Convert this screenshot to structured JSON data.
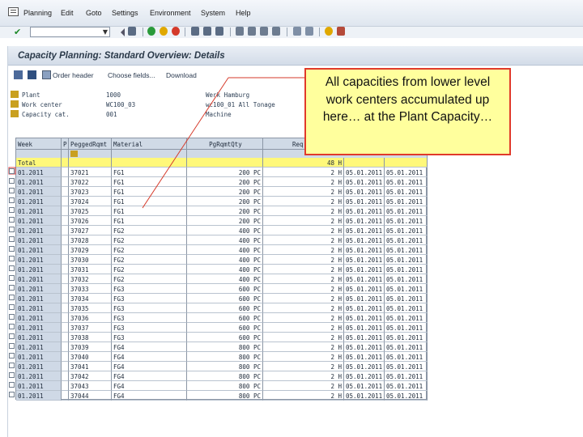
{
  "menubar": {
    "items": [
      "Planning",
      "Edit",
      "Goto",
      "Settings",
      "Environment",
      "System",
      "Help"
    ]
  },
  "toolbar": {
    "command_value": ""
  },
  "title": {
    "text": "Capacity Planning: Standard Overview: Details"
  },
  "app_toolbar": {
    "order_header": "Order header",
    "choose_fields": "Choose fields...",
    "download": "Download"
  },
  "header": {
    "plant_label": "Plant",
    "plant_value": "1000",
    "plant_desc": "Werk Hamburg",
    "work_center_label": "Work center",
    "work_center_value": "WC100_03",
    "work_center_desc": "wc100_01 All Tonage",
    "capacity_cat_label": "Capacity cat.",
    "capacity_cat_value": "001",
    "capacity_cat_desc": "Machine"
  },
  "grid": {
    "columns": {
      "week": "Week",
      "p": "P",
      "pegged": "PeggedRqmt",
      "material": "Material",
      "pgqty": "PgRqmtQty",
      "req": "Req"
    },
    "total": {
      "week": "Total",
      "req": "48 H"
    },
    "rows": [
      {
        "week": "01.2011",
        "pegged": "37021",
        "material": "FG1",
        "pgqty": "200 PC",
        "req": "2 H",
        "d1": "05.01.2011",
        "d2": "05.01.2011"
      },
      {
        "week": "01.2011",
        "pegged": "37022",
        "material": "FG1",
        "pgqty": "200 PC",
        "req": "2 H",
        "d1": "05.01.2011",
        "d2": "05.01.2011"
      },
      {
        "week": "01.2011",
        "pegged": "37023",
        "material": "FG1",
        "pgqty": "200 PC",
        "req": "2 H",
        "d1": "05.01.2011",
        "d2": "05.01.2011"
      },
      {
        "week": "01.2011",
        "pegged": "37024",
        "material": "FG1",
        "pgqty": "200 PC",
        "req": "2 H",
        "d1": "05.01.2011",
        "d2": "05.01.2011"
      },
      {
        "week": "01.2011",
        "pegged": "37025",
        "material": "FG1",
        "pgqty": "200 PC",
        "req": "2 H",
        "d1": "05.01.2011",
        "d2": "05.01.2011"
      },
      {
        "week": "01.2011",
        "pegged": "37026",
        "material": "FG1",
        "pgqty": "200 PC",
        "req": "2 H",
        "d1": "05.01.2011",
        "d2": "05.01.2011"
      },
      {
        "week": "01.2011",
        "pegged": "37027",
        "material": "FG2",
        "pgqty": "400 PC",
        "req": "2 H",
        "d1": "05.01.2011",
        "d2": "05.01.2011"
      },
      {
        "week": "01.2011",
        "pegged": "37028",
        "material": "FG2",
        "pgqty": "400 PC",
        "req": "2 H",
        "d1": "05.01.2011",
        "d2": "05.01.2011"
      },
      {
        "week": "01.2011",
        "pegged": "37029",
        "material": "FG2",
        "pgqty": "400 PC",
        "req": "2 H",
        "d1": "05.01.2011",
        "d2": "05.01.2011"
      },
      {
        "week": "01.2011",
        "pegged": "37030",
        "material": "FG2",
        "pgqty": "400 PC",
        "req": "2 H",
        "d1": "05.01.2011",
        "d2": "05.01.2011"
      },
      {
        "week": "01.2011",
        "pegged": "37031",
        "material": "FG2",
        "pgqty": "400 PC",
        "req": "2 H",
        "d1": "05.01.2011",
        "d2": "05.01.2011"
      },
      {
        "week": "01.2011",
        "pegged": "37032",
        "material": "FG2",
        "pgqty": "400 PC",
        "req": "2 H",
        "d1": "05.01.2011",
        "d2": "05.01.2011"
      },
      {
        "week": "01.2011",
        "pegged": "37033",
        "material": "FG3",
        "pgqty": "600 PC",
        "req": "2 H",
        "d1": "05.01.2011",
        "d2": "05.01.2011"
      },
      {
        "week": "01.2011",
        "pegged": "37034",
        "material": "FG3",
        "pgqty": "600 PC",
        "req": "2 H",
        "d1": "05.01.2011",
        "d2": "05.01.2011"
      },
      {
        "week": "01.2011",
        "pegged": "37035",
        "material": "FG3",
        "pgqty": "600 PC",
        "req": "2 H",
        "d1": "05.01.2011",
        "d2": "05.01.2011"
      },
      {
        "week": "01.2011",
        "pegged": "37036",
        "material": "FG3",
        "pgqty": "600 PC",
        "req": "2 H",
        "d1": "05.01.2011",
        "d2": "05.01.2011"
      },
      {
        "week": "01.2011",
        "pegged": "37037",
        "material": "FG3",
        "pgqty": "600 PC",
        "req": "2 H",
        "d1": "05.01.2011",
        "d2": "05.01.2011"
      },
      {
        "week": "01.2011",
        "pegged": "37038",
        "material": "FG3",
        "pgqty": "600 PC",
        "req": "2 H",
        "d1": "05.01.2011",
        "d2": "05.01.2011"
      },
      {
        "week": "01.2011",
        "pegged": "37039",
        "material": "FG4",
        "pgqty": "800 PC",
        "req": "2 H",
        "d1": "05.01.2011",
        "d2": "05.01.2011"
      },
      {
        "week": "01.2011",
        "pegged": "37040",
        "material": "FG4",
        "pgqty": "800 PC",
        "req": "2 H",
        "d1": "05.01.2011",
        "d2": "05.01.2011"
      },
      {
        "week": "01.2011",
        "pegged": "37041",
        "material": "FG4",
        "pgqty": "800 PC",
        "req": "2 H",
        "d1": "05.01.2011",
        "d2": "05.01.2011"
      },
      {
        "week": "01.2011",
        "pegged": "37042",
        "material": "FG4",
        "pgqty": "800 PC",
        "req": "2 H",
        "d1": "05.01.2011",
        "d2": "05.01.2011"
      },
      {
        "week": "01.2011",
        "pegged": "37043",
        "material": "FG4",
        "pgqty": "800 PC",
        "req": "2 H",
        "d1": "05.01.2011",
        "d2": "05.01.2011"
      },
      {
        "week": "01.2011",
        "pegged": "37044",
        "material": "FG4",
        "pgqty": "800 PC",
        "req": "2 H",
        "d1": "05.01.2011",
        "d2": "05.01.2011"
      }
    ]
  },
  "callout": {
    "text": "All capacities from lower level work centers accumulated up here… at the Plant Capacity…"
  },
  "colors": {
    "total_row": "#fff87a",
    "callout_bg": "#ffff9d",
    "callout_border": "#e03a2a"
  }
}
